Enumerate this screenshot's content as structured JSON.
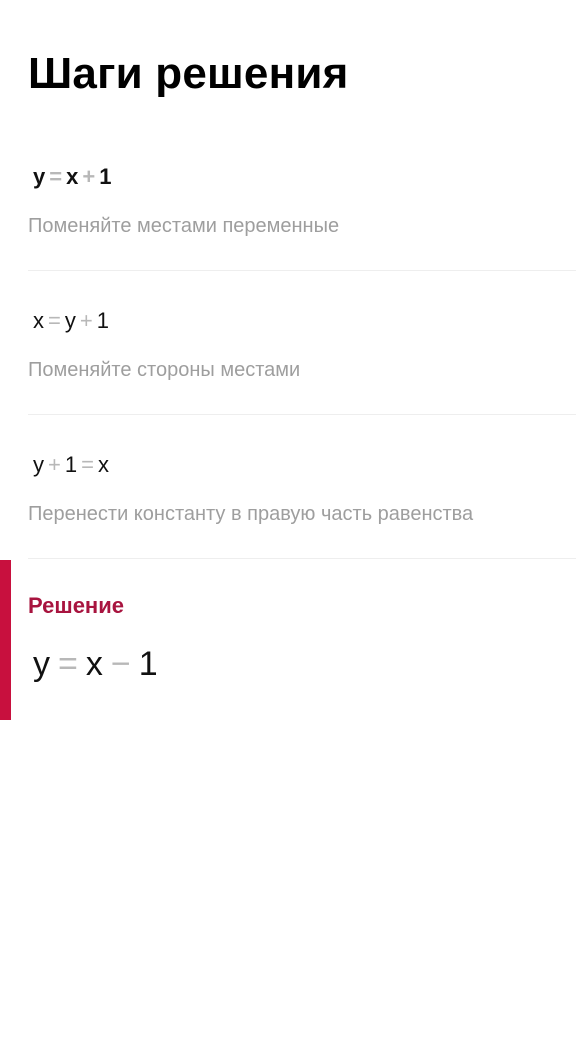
{
  "header": {
    "title": "Шаги решения"
  },
  "steps": [
    {
      "equation": {
        "a": "y",
        "op1": "=",
        "b": "x",
        "op2": "+",
        "c": "1"
      },
      "description": "Поменяйте местами переменные"
    },
    {
      "equation": {
        "a": "x",
        "op1": "=",
        "b": "y",
        "op2": "+",
        "c": "1"
      },
      "description": "Поменяйте стороны местами"
    },
    {
      "equation": {
        "a": "y",
        "op1": "+",
        "b": "1",
        "op2": "=",
        "c": "x"
      },
      "description": "Перенести константу в правую часть равенства"
    }
  ],
  "solution": {
    "label": "Решение",
    "equation": {
      "a": "y",
      "op1": "=",
      "b": "x",
      "op2": "−",
      "c": "1"
    }
  },
  "colors": {
    "accent": "#c8103e",
    "accent_text": "#a8143f",
    "operator": "#b8b8b8",
    "description": "#9e9e9e",
    "divider": "#eeeeee"
  }
}
